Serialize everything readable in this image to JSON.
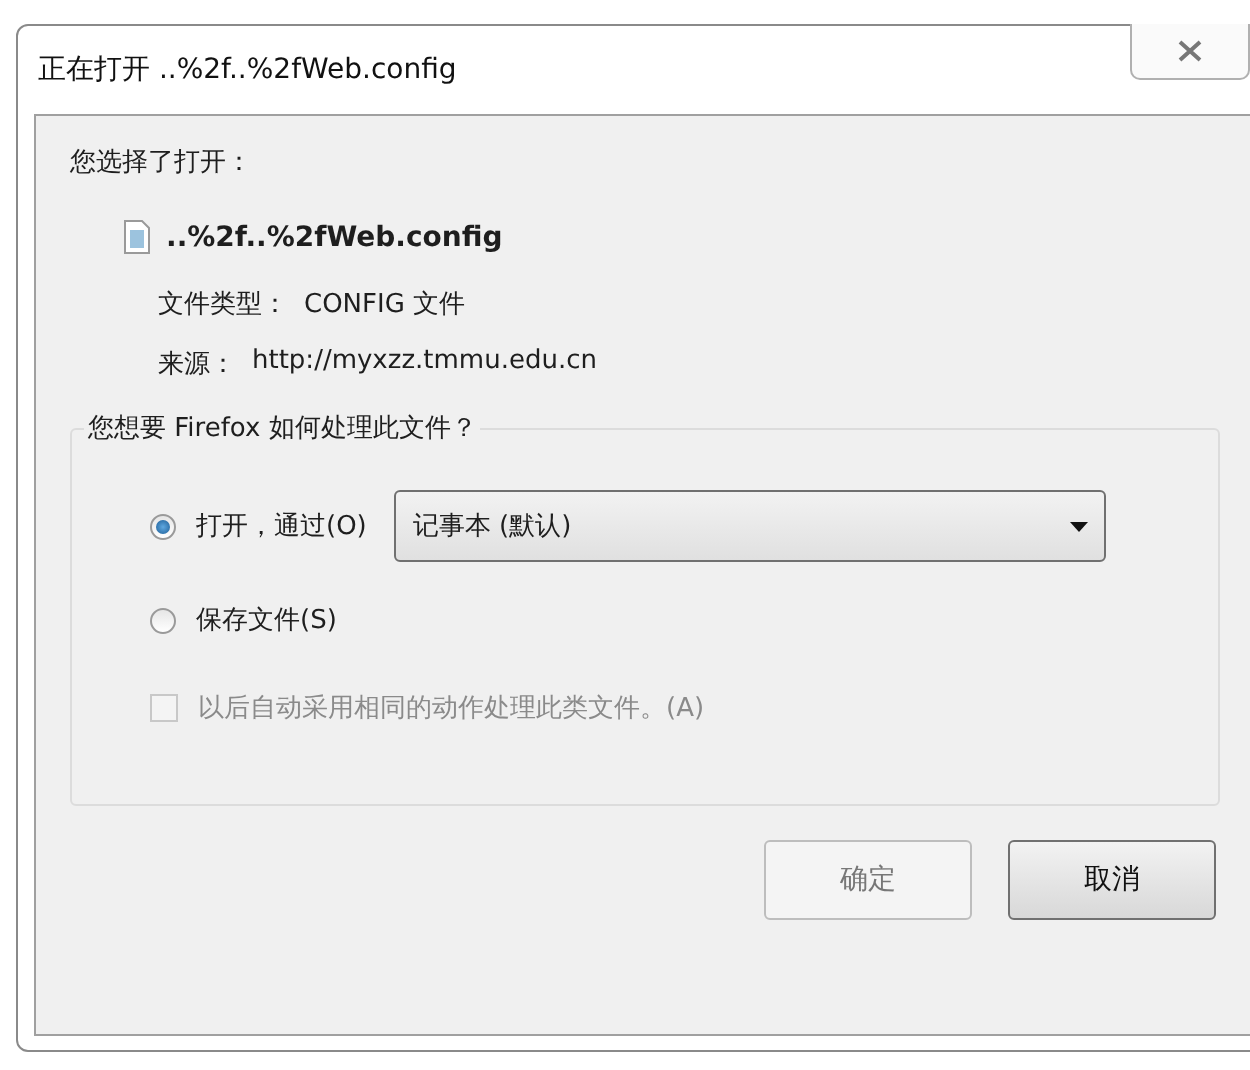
{
  "window": {
    "title": "正在打开 ..%2f..%2fWeb.config"
  },
  "intro": "您选择了打开：",
  "file": {
    "name": "..%2f..%2fWeb.config",
    "type_label": "文件类型：",
    "type_value": "CONFIG 文件",
    "source_label": "来源：",
    "source_value": "http://myxzz.tmmu.edu.cn"
  },
  "group": {
    "title": "您想要 Firefox 如何处理此文件？",
    "options": [
      {
        "label": "打开，通过(O)",
        "selected": true
      },
      {
        "label": "保存文件(S)",
        "selected": false
      }
    ],
    "app_select": {
      "value": "记事本 (默认)"
    },
    "remember": {
      "label": "以后自动采用相同的动作处理此类文件。(A)",
      "checked": false,
      "disabled": true
    }
  },
  "buttons": [
    {
      "label": "确定",
      "disabled": true
    },
    {
      "label": "取消",
      "disabled": false
    }
  ]
}
